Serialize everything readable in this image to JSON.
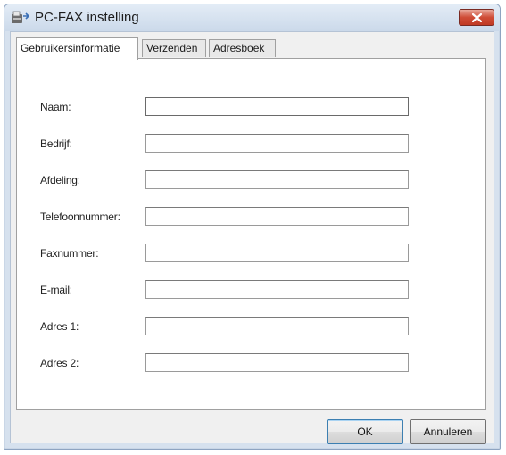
{
  "window": {
    "title": "PC-FAX instelling"
  },
  "tabs": [
    {
      "label": "Gebruikersinformatie",
      "active": true
    },
    {
      "label": "Verzenden",
      "active": false
    },
    {
      "label": "Adresboek",
      "active": false
    }
  ],
  "form": {
    "fields": [
      {
        "label": "Naam:",
        "value": ""
      },
      {
        "label": "Bedrijf:",
        "value": ""
      },
      {
        "label": "Afdeling:",
        "value": ""
      },
      {
        "label": "Telefoonnummer:",
        "value": ""
      },
      {
        "label": "Faxnummer:",
        "value": ""
      },
      {
        "label": "E-mail:",
        "value": ""
      },
      {
        "label": "Adres 1:",
        "value": ""
      },
      {
        "label": "Adres 2:",
        "value": ""
      }
    ]
  },
  "buttons": {
    "ok_label": "OK",
    "cancel_label": "Annuleren"
  },
  "icons": {
    "app": "fax-machine-icon",
    "close": "close-icon"
  },
  "colors": {
    "close_button": "#c9452f",
    "title_bar": "#d6e1ee",
    "focus_border": "#3c7fb1"
  }
}
